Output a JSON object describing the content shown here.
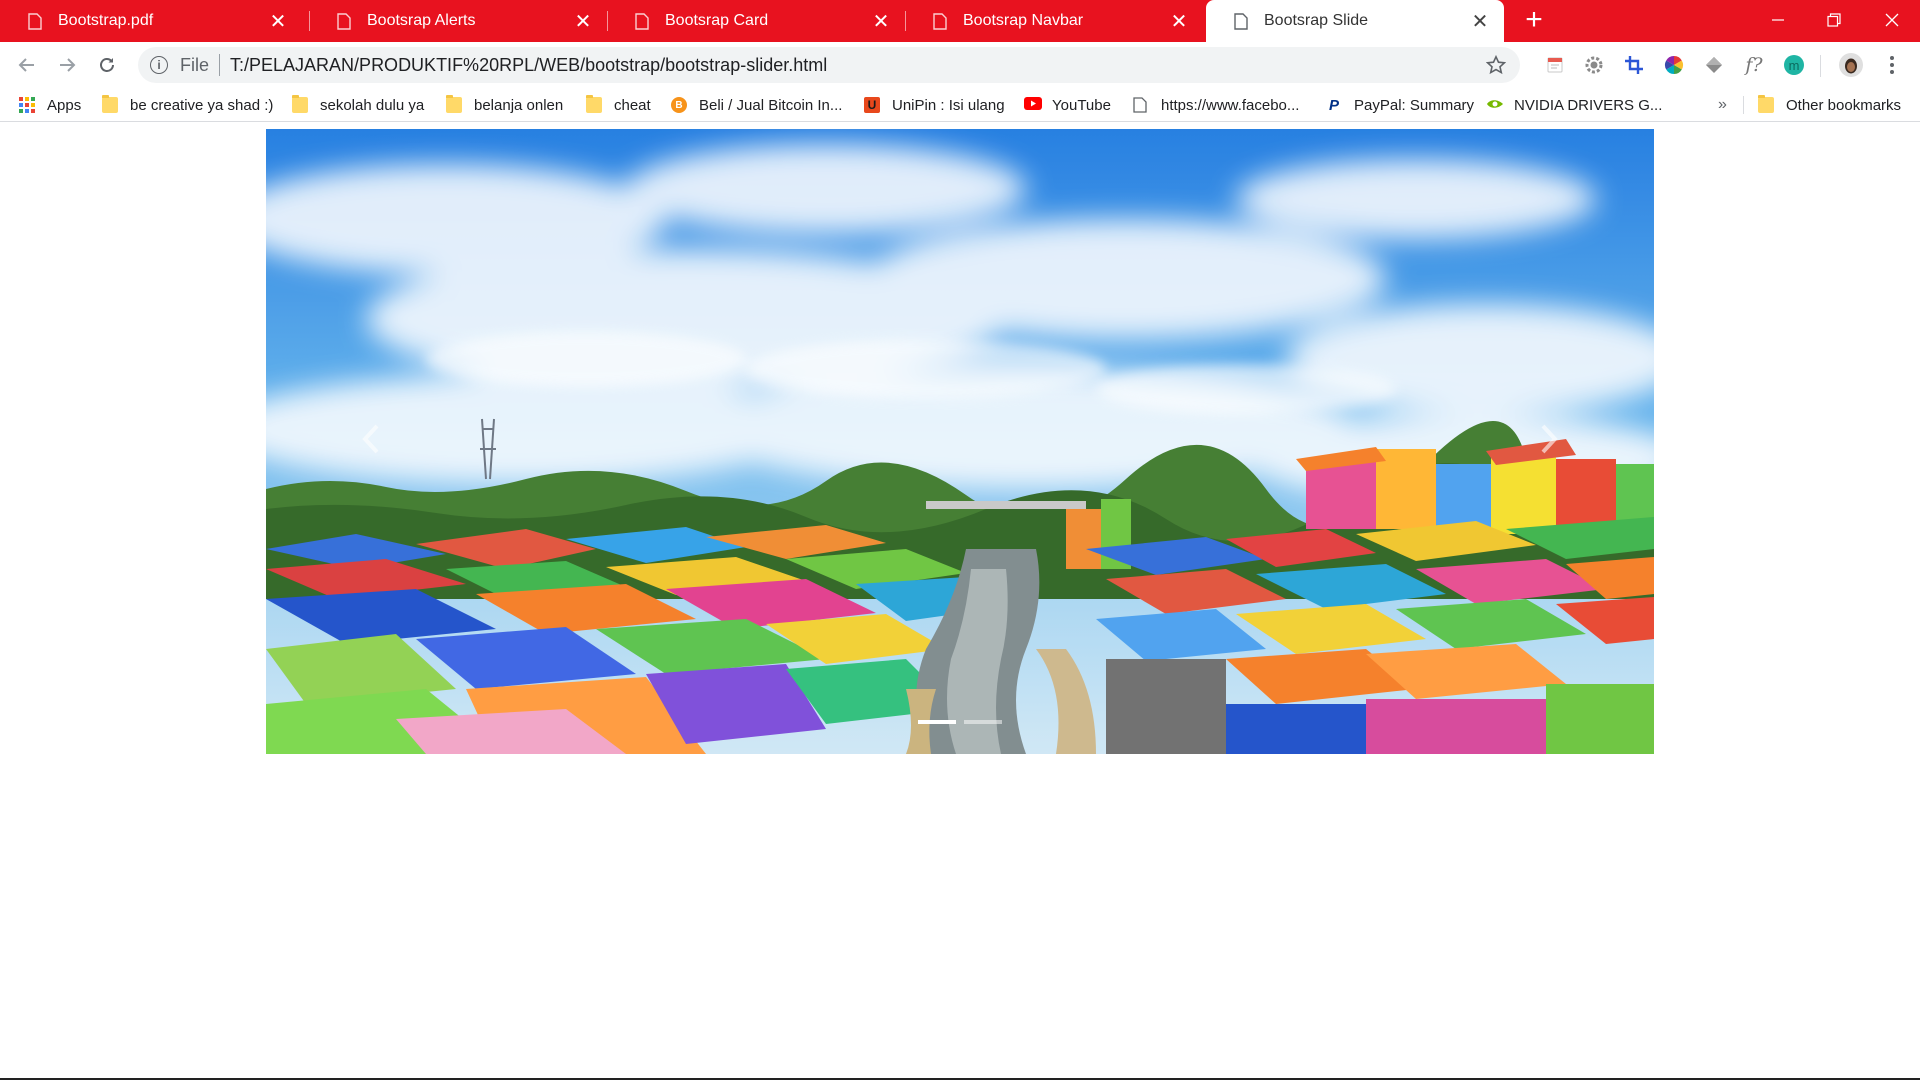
{
  "browser": {
    "tabs": [
      {
        "title": "Bootstrap.pdf",
        "active": false
      },
      {
        "title": "Bootsrap Alerts",
        "active": false
      },
      {
        "title": "Bootsrap Card",
        "active": false
      },
      {
        "title": "Bootsrap Navbar",
        "active": false
      },
      {
        "title": "Bootsrap Slide",
        "active": true
      }
    ],
    "new_tab_symbol": "+",
    "accent_color": "#e8121f"
  },
  "toolbar": {
    "scheme": "File",
    "url": "T:/PELAJARAN/PRODUKTIF%20RPL/WEB/bootstrap/bootstrap-slider.html",
    "extensions": [
      "note-icon",
      "gear-icon",
      "crop-icon",
      "color-wheel-icon",
      "layers-icon",
      "formula-icon",
      "circle-m-icon",
      "avatar",
      "more-icon"
    ],
    "formula_glyph": "f?",
    "circle_letter": "m"
  },
  "bookmarks": {
    "items": [
      {
        "label": "Apps",
        "icon": "apps-grid-icon"
      },
      {
        "label": "be creative ya shad :)",
        "icon": "folder-icon"
      },
      {
        "label": "sekolah dulu ya",
        "icon": "folder-icon"
      },
      {
        "label": "belanja onlen",
        "icon": "folder-icon"
      },
      {
        "label": "cheat",
        "icon": "folder-icon"
      },
      {
        "label": "Beli / Jual Bitcoin In...",
        "icon": "bitcoin-icon"
      },
      {
        "label": "UniPin : Isi ulang",
        "icon": "unipin-icon"
      },
      {
        "label": "YouTube",
        "icon": "youtube-icon"
      },
      {
        "label": "https://www.facebo...",
        "icon": "page-icon"
      },
      {
        "label": "PayPal: Summary",
        "icon": "paypal-icon"
      },
      {
        "label": "NVIDIA DRIVERS G...",
        "icon": "nvidia-icon"
      }
    ],
    "overflow_symbol": "»",
    "other": "Other bookmarks",
    "bitcoin_glyph": "B",
    "unipin_glyph": "U",
    "paypal_glyph": "P"
  },
  "carousel": {
    "slide_count": 2,
    "active_index": 0,
    "scene": "colorful-village-river-photo"
  }
}
